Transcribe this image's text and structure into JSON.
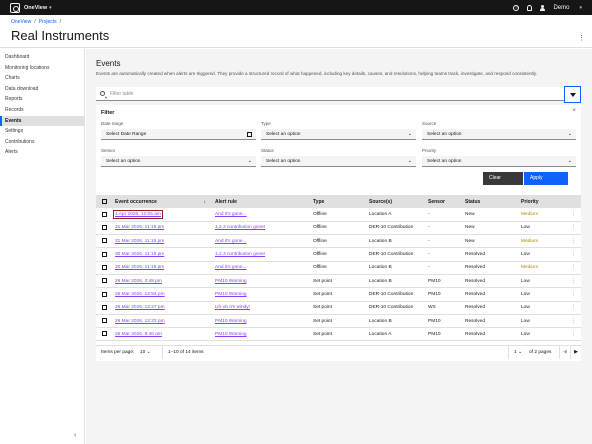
{
  "topbar": {
    "brand": "OneView",
    "user": "Demo"
  },
  "breadcrumb": [
    "OneView",
    "Projects"
  ],
  "page_title": "Real Instruments",
  "sidebar": {
    "items": [
      {
        "label": "Dashboard"
      },
      {
        "label": "Monitoring locations"
      },
      {
        "label": "Charts"
      },
      {
        "label": "Data download"
      },
      {
        "label": "Reports"
      },
      {
        "label": "Records"
      },
      {
        "label": "Events",
        "active": true
      },
      {
        "label": "Settings"
      },
      {
        "label": "Contributions"
      },
      {
        "label": "Alerts"
      }
    ]
  },
  "events": {
    "title": "Events",
    "description": "Events are automatically created when alerts are triggered. They provide a structured record of what happened, including key details, causes, and resolutions, helping teams track, investigate, and respond consistently.",
    "search_placeholder": "Filter table"
  },
  "filter": {
    "title": "Filter",
    "date_label": "Date range",
    "date_value": "Select Date Range",
    "type_label": "Type",
    "type_value": "Select an option",
    "source_label": "Source",
    "source_value": "Select an option",
    "sensor_label": "Sensor",
    "sensor_value": "Select an option",
    "status_label": "Status",
    "status_value": "Select an option",
    "priority_label": "Priority",
    "priority_value": "Select an option",
    "clear_label": "Clear",
    "apply_label": "Apply"
  },
  "table": {
    "headers": [
      "Event occurrence",
      "Alert rule",
      "Type",
      "Source(s)",
      "Sensor",
      "Status",
      "Priority"
    ],
    "rows": [
      {
        "occ": "1 Apr 2026, 12:05 am",
        "rule": "And it's gone...",
        "type": "Offline",
        "source": "Location A",
        "sensor": "-",
        "status": "New",
        "priority": "Medium"
      },
      {
        "occ": "31 Mar 2026, 11:15 pm",
        "rule": "1,2,3 contribution gone!",
        "type": "Offline",
        "source": "DER-10 Contribution",
        "sensor": "-",
        "status": "New",
        "priority": "Low"
      },
      {
        "occ": "31 Mar 2026, 11:15 pm",
        "rule": "And it's gone...",
        "type": "Offline",
        "source": "Location B",
        "sensor": "-",
        "status": "New",
        "priority": "Medium"
      },
      {
        "occ": "30 Mar 2026, 11:15 pm",
        "rule": "1,2,3 contribution gone!",
        "type": "Offline",
        "source": "DER-10 Contribution",
        "sensor": "-",
        "status": "Resolved",
        "priority": "Low"
      },
      {
        "occ": "30 Mar 2026, 11:15 pm",
        "rule": "And it's gone...",
        "type": "Offline",
        "source": "Location B",
        "sensor": "-",
        "status": "Resolved",
        "priority": "Medium"
      },
      {
        "occ": "26 Mar 2026, 3:48 pm",
        "rule": "PM10 Warning",
        "type": "Set point",
        "source": "Location B",
        "sensor": "PM10",
        "status": "Resolved",
        "priority": "Low"
      },
      {
        "occ": "26 Mar 2026, 12:54 pm",
        "rule": "PM10 Warning",
        "type": "Set point",
        "source": "DER-10 Contribution",
        "sensor": "PM10",
        "status": "Resolved",
        "priority": "Low"
      },
      {
        "occ": "26 Mar 2026, 12:27 pm",
        "rule": "Uh-oh it's windy!",
        "type": "Set point",
        "source": "DER-10 Contribution",
        "sensor": "WS",
        "status": "Resolved",
        "priority": "Low"
      },
      {
        "occ": "26 Mar 2026, 12:23 pm",
        "rule": "PM10 Warning",
        "type": "Set point",
        "source": "Location B",
        "sensor": "PM10",
        "status": "Resolved",
        "priority": "Low"
      },
      {
        "occ": "26 Mar 2026, 8:40 am",
        "rule": "PM10 Warning",
        "type": "Set point",
        "source": "Location A",
        "sensor": "PM10",
        "status": "Resolved",
        "priority": "Low"
      }
    ]
  },
  "pagination": {
    "items_per_page_label": "Items per page:",
    "page_size": "10",
    "range_text": "1–10 of 14 items",
    "current_page": "1",
    "of_pages": "of 2 pages"
  },
  "colors": {
    "accent": "#0f62fe",
    "link": "#8a3ffc",
    "medium": "#b28600",
    "highlight": "#a2191f"
  }
}
